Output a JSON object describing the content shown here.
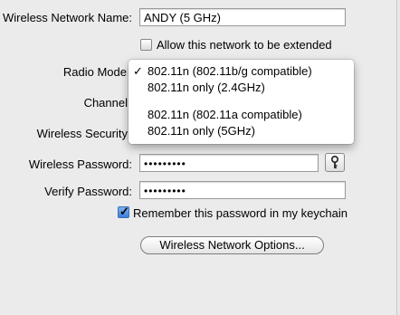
{
  "network_name": {
    "label": "Wireless Network Name:",
    "value": "ANDY (5 GHz)"
  },
  "allow_extend": {
    "label": "Allow this network to be extended",
    "checked": false
  },
  "radio_mode": {
    "label": "Radio Mode",
    "options": [
      {
        "label": "802.11n (802.11b/g compatible)",
        "selected": true,
        "check": "✓"
      },
      {
        "label": "802.11n only (2.4GHz)",
        "selected": false
      },
      {
        "label": "802.11n (802.11a compatible)",
        "selected": false
      },
      {
        "label": "802.11n only (5GHz)",
        "selected": false
      }
    ]
  },
  "channel": {
    "label": "Channel"
  },
  "security": {
    "label": "Wireless Security"
  },
  "password": {
    "label": "Wireless Password:",
    "value": "•••••••••"
  },
  "verify_password": {
    "label": "Verify Password:",
    "value": "•••••••••"
  },
  "remember": {
    "label": "Remember this password in my keychain",
    "checked": true
  },
  "options_button": {
    "label": "Wireless Network Options..."
  },
  "icons": {
    "key": "key-icon",
    "check": "checkmark-icon"
  },
  "colors": {
    "checkbox_on": "#3d7fd9",
    "menu_bg": "#ffffff",
    "pane_bg": "#ebebeb"
  }
}
